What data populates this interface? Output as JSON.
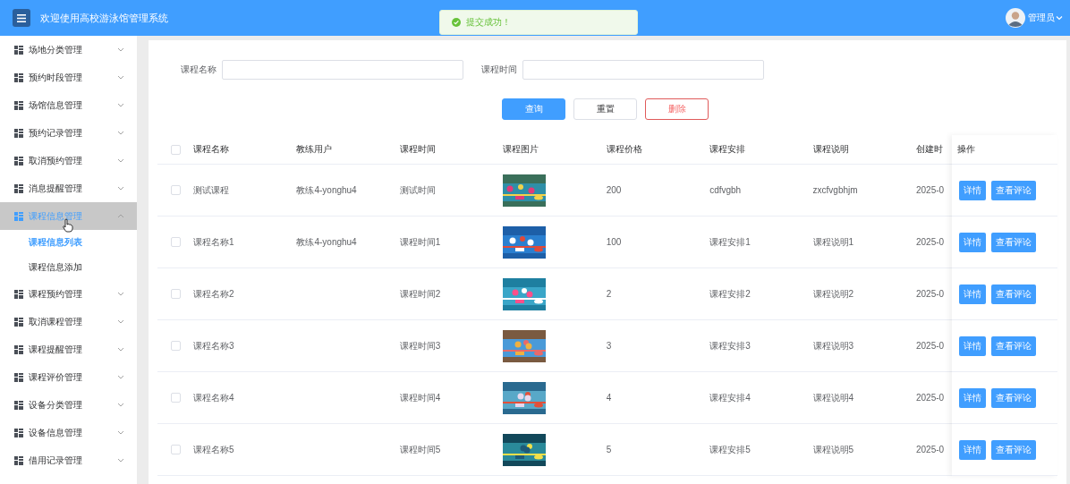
{
  "header": {
    "title": "欢迎使用高校游泳馆管理系统",
    "user": "管理员"
  },
  "toast": {
    "message": "提交成功！"
  },
  "sidebar": {
    "items": [
      {
        "label": "场地分类管理",
        "expanded": false,
        "hovered": false
      },
      {
        "label": "预约时段管理",
        "expanded": false,
        "hovered": false
      },
      {
        "label": "场馆信息管理",
        "expanded": false,
        "hovered": false
      },
      {
        "label": "预约记录管理",
        "expanded": false,
        "hovered": false
      },
      {
        "label": "取消预约管理",
        "expanded": false,
        "hovered": false
      },
      {
        "label": "消息提醒管理",
        "expanded": false,
        "hovered": false
      },
      {
        "label": "课程信息管理",
        "expanded": true,
        "hovered": true,
        "children": [
          {
            "label": "课程信息列表",
            "selected": true
          },
          {
            "label": "课程信息添加",
            "selected": false
          }
        ]
      },
      {
        "label": "课程预约管理",
        "expanded": false,
        "hovered": false
      },
      {
        "label": "取消课程管理",
        "expanded": false,
        "hovered": false
      },
      {
        "label": "课程提醒管理",
        "expanded": false,
        "hovered": false
      },
      {
        "label": "课程评价管理",
        "expanded": false,
        "hovered": false
      },
      {
        "label": "设备分类管理",
        "expanded": false,
        "hovered": false
      },
      {
        "label": "设备信息管理",
        "expanded": false,
        "hovered": false
      },
      {
        "label": "借用记录管理",
        "expanded": false,
        "hovered": false
      }
    ]
  },
  "filters": [
    {
      "label": "课程名称"
    },
    {
      "label": "课程时间"
    }
  ],
  "buttons": [
    {
      "label": "查询",
      "kind": "primary"
    },
    {
      "label": "重置",
      "kind": "default"
    },
    {
      "label": "删除",
      "kind": "danger"
    }
  ],
  "table": {
    "columns": [
      "课程名称",
      "教练用户",
      "课程时间",
      "课程图片",
      "课程价格",
      "课程安排",
      "课程说明",
      "创建时"
    ],
    "actions_column": "操作",
    "all_checked": false,
    "rows": [
      {
        "checked": false,
        "cells": [
          "测试课程",
          "教练4-yonghu4",
          "测试时间",
          {
            "kind": "picture"
          },
          "200",
          "cdfvgbh",
          "zxcfvgbhjm",
          "2025-0"
        ],
        "actions": [
          "详情",
          "查看评论"
        ]
      },
      {
        "checked": false,
        "cells": [
          "课程名称1",
          "教练4-yonghu4",
          "课程时间1",
          {
            "kind": "picture"
          },
          "100",
          "课程安排1",
          "课程说明1",
          "2025-0"
        ],
        "actions": [
          "详情",
          "查看评论"
        ]
      },
      {
        "checked": false,
        "cells": [
          "课程名称2",
          "",
          "课程时间2",
          {
            "kind": "picture"
          },
          "2",
          "课程安排2",
          "课程说明2",
          "2025-0"
        ],
        "actions": [
          "详情",
          "查看评论"
        ]
      },
      {
        "checked": false,
        "cells": [
          "课程名称3",
          "",
          "课程时间3",
          {
            "kind": "picture"
          },
          "3",
          "课程安排3",
          "课程说明3",
          "2025-0"
        ],
        "actions": [
          "详情",
          "查看评论"
        ]
      },
      {
        "checked": false,
        "cells": [
          "课程名称4",
          "",
          "课程时间4",
          {
            "kind": "picture"
          },
          "4",
          "课程安排4",
          "课程说明4",
          "2025-0"
        ],
        "actions": [
          "详情",
          "查看评论"
        ]
      },
      {
        "checked": false,
        "cells": [
          "课程名称5",
          "",
          "课程时间5",
          {
            "kind": "picture"
          },
          "5",
          "课程安排5",
          "课程说明5",
          "2025-0"
        ],
        "actions": [
          "详情",
          "查看评论"
        ]
      }
    ]
  }
}
